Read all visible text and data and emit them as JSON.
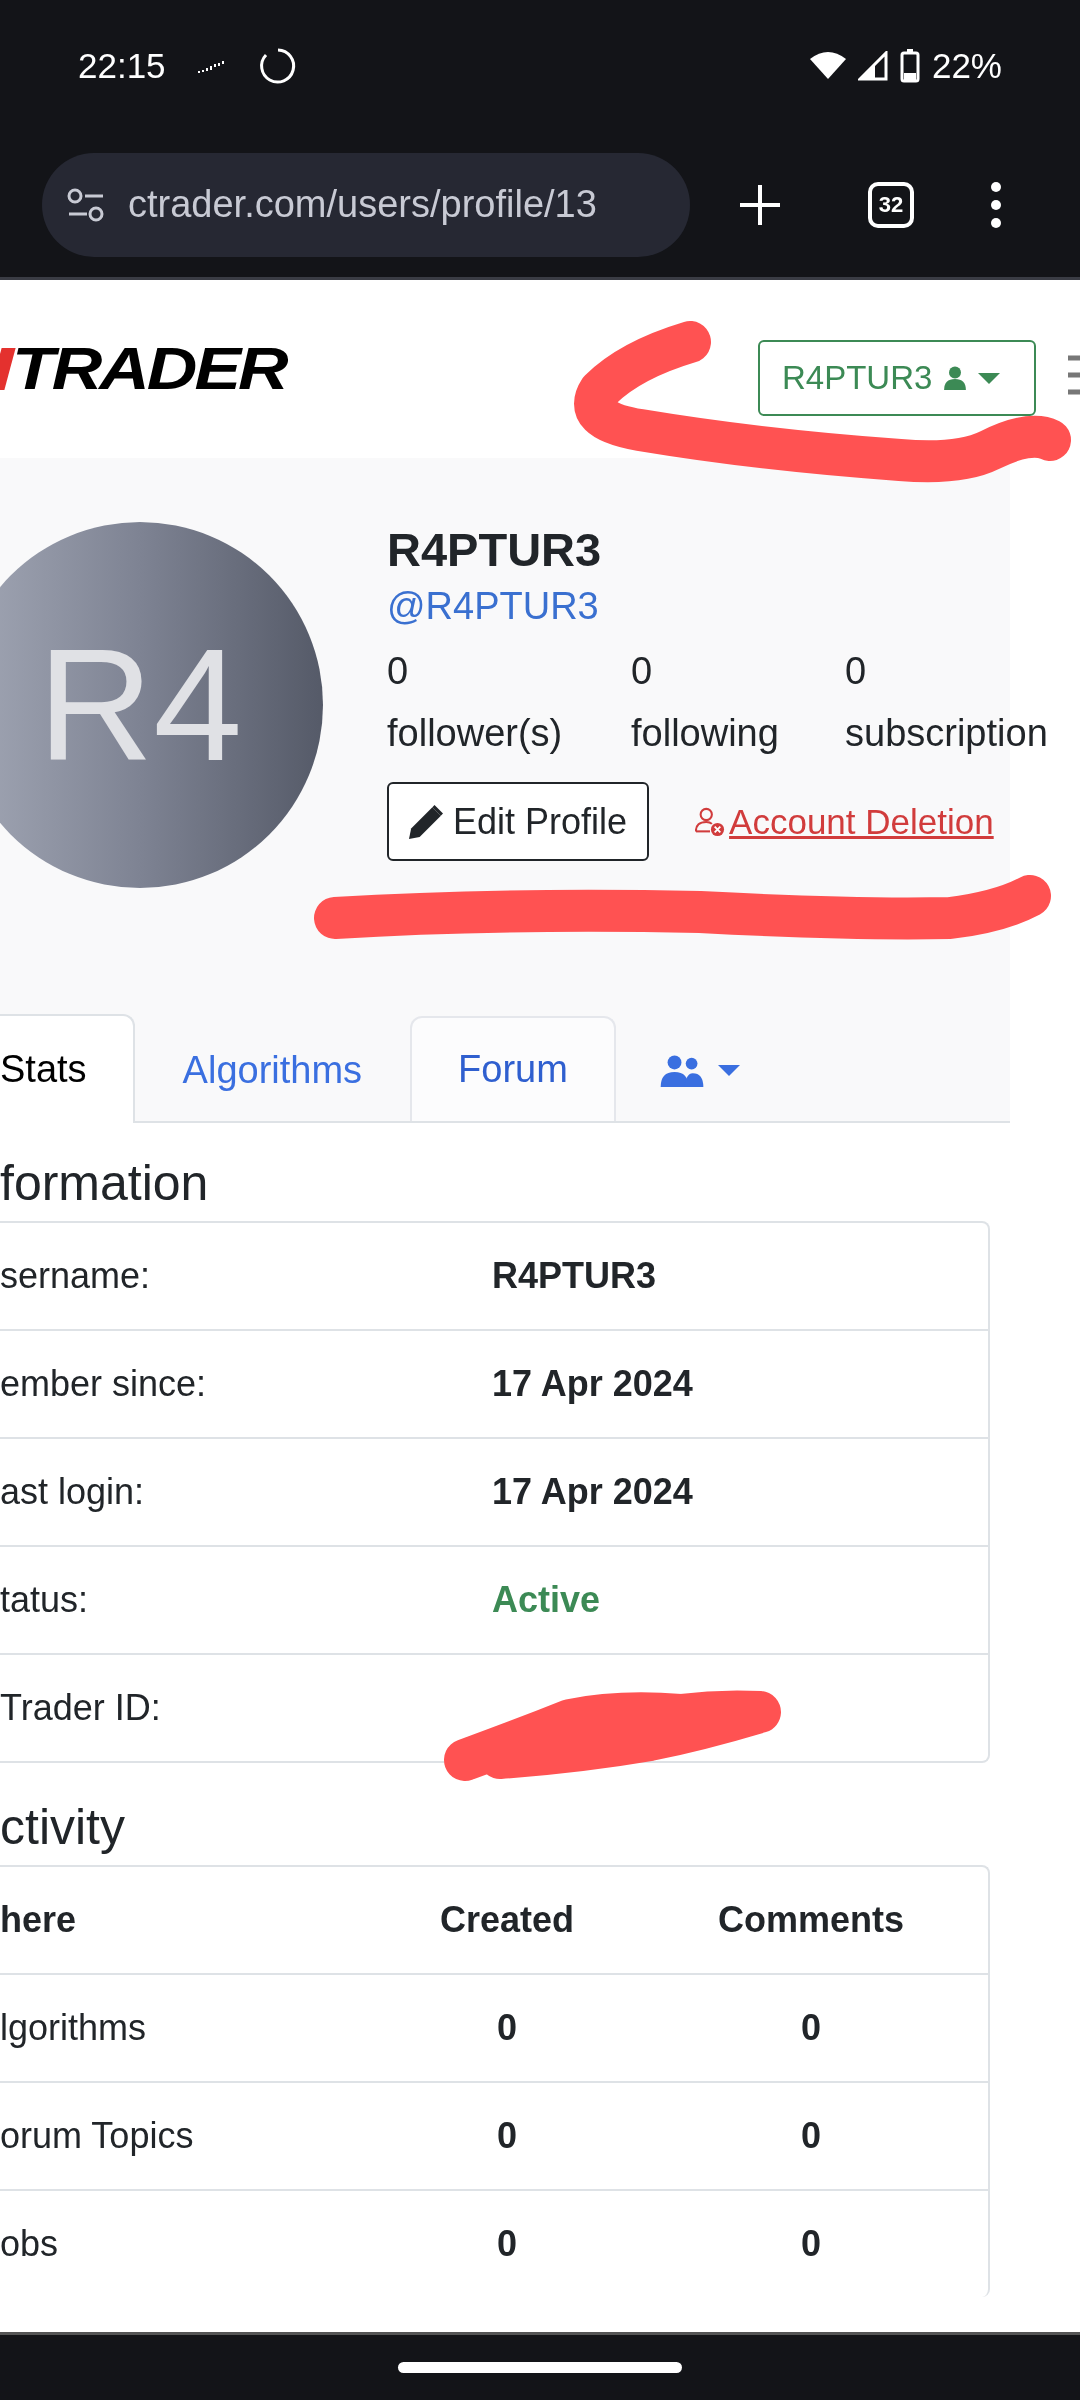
{
  "status_bar": {
    "time": "22:15",
    "battery": "22%"
  },
  "browser": {
    "url": "ctrader.com/users/profile/13",
    "tab_count": "32"
  },
  "header": {
    "logo": "TRADER",
    "user_button": "R4PTUR3"
  },
  "profile": {
    "initials": "R4",
    "name": "R4PTUR3",
    "handle": "@R4PTUR3",
    "stats": [
      {
        "value": "0",
        "label": "follower(s)"
      },
      {
        "value": "0",
        "label": "following"
      },
      {
        "value": "0",
        "label": "subscription"
      }
    ],
    "edit_button": "Edit Profile",
    "delete_link": "Account Deletion"
  },
  "tabs": [
    {
      "kind": "text",
      "label": "Stats",
      "selected": true,
      "hovered": false
    },
    {
      "kind": "text",
      "label": "Algorithms",
      "selected": false,
      "hovered": false
    },
    {
      "kind": "text",
      "label": "Forum",
      "selected": false,
      "hovered": true
    },
    {
      "kind": "menu",
      "selected": false,
      "hovered": false
    }
  ],
  "information": {
    "title": "formation",
    "rows": [
      {
        "kind": "text",
        "label": "sername:",
        "value": "R4PTUR3"
      },
      {
        "kind": "text",
        "label": "ember since:",
        "value": "17 Apr 2024"
      },
      {
        "kind": "text",
        "label": "ast login:",
        "value": "17 Apr 2024"
      },
      {
        "kind": "status",
        "label": "tatus:",
        "value": "Active"
      },
      {
        "kind": "hidden",
        "label": "Trader ID:"
      }
    ]
  },
  "activity": {
    "title": "ctivity",
    "columns": [
      "here",
      "Created",
      "Comments"
    ],
    "rows": [
      {
        "where": "lgorithms",
        "created": "0",
        "comments": "0"
      },
      {
        "where": "orum Topics",
        "created": "0",
        "comments": "0"
      },
      {
        "where": "obs",
        "created": "0",
        "comments": "0"
      }
    ]
  }
}
